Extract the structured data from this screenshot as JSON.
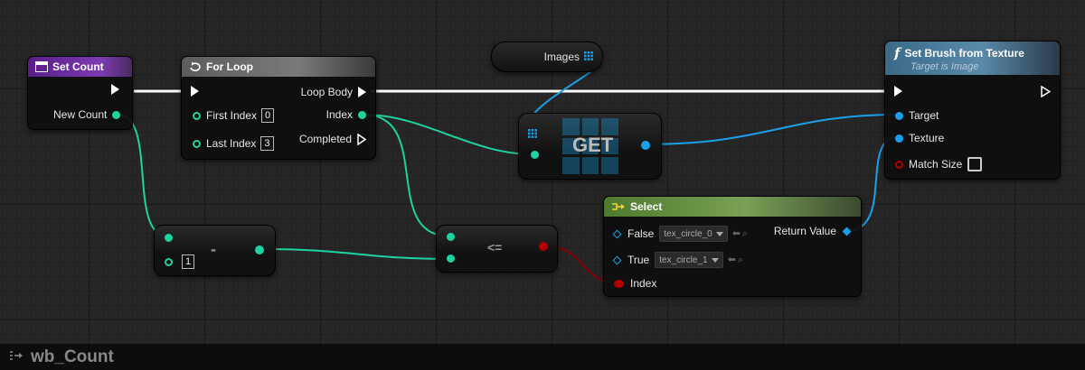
{
  "graph": {
    "name": "wb_Count",
    "icon": "function-graph-icon"
  },
  "nodes": {
    "set_count": {
      "title": "Set Count",
      "header_color": "#6a2a9b",
      "icon": "variable-set-icon",
      "pins": {
        "new_count": "New Count"
      }
    },
    "for_loop": {
      "title": "For Loop",
      "header_color": "#6a6a6a",
      "icon": "loop-icon",
      "pins": {
        "first_index": "First Index",
        "first_index_value": "0",
        "last_index": "Last Index",
        "last_index_value": "3",
        "loop_body": "Loop Body",
        "index": "Index",
        "completed": "Completed"
      }
    },
    "images": {
      "label": "Images",
      "icon": "array-grid-icon"
    },
    "get": {
      "title": "GET",
      "icon": "array-grid-icon"
    },
    "set_brush": {
      "title": "Set Brush from Texture",
      "subtitle": "Target is Image",
      "header_color": "#3d6f8e",
      "icon": "function-icon",
      "pins": {
        "target": "Target",
        "texture": "Texture",
        "match_size": "Match Size"
      }
    },
    "subtract": {
      "title": "-",
      "input_value": "1"
    },
    "less_equal": {
      "title": "<="
    },
    "select": {
      "title": "Select",
      "header_color": "#5f8a3c",
      "icon": "select-icon",
      "pins": {
        "false_label": "False",
        "false_value": "tex_circle_0",
        "true_label": "True",
        "true_value": "tex_circle_1",
        "index": "Index",
        "return_value": "Return Value"
      }
    }
  },
  "colors": {
    "int_pin": "#1ed3a0",
    "object_pin": "#1aa0e8",
    "bool_pin": "#b30000",
    "exec_wire": "#ffffff"
  }
}
